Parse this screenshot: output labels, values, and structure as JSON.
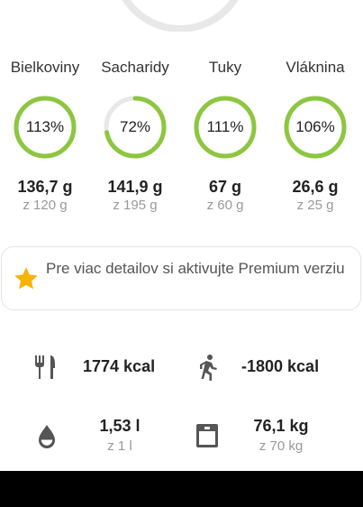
{
  "colors": {
    "accent": "#8dc63f",
    "track": "#e8e8e8",
    "star": "#f6b400",
    "icon": "#555555"
  },
  "macros": [
    {
      "label": "Bielkoviny",
      "percent_text": "113%",
      "percent": 113,
      "value": "136,7 g",
      "goal": "z 120 g"
    },
    {
      "label": "Sacharidy",
      "percent_text": "72%",
      "percent": 72,
      "value": "141,9 g",
      "goal": "z 195 g"
    },
    {
      "label": "Tuky",
      "percent_text": "111%",
      "percent": 111,
      "value": "67 g",
      "goal": "z 60 g"
    },
    {
      "label": "Vláknina",
      "percent_text": "106%",
      "percent": 106,
      "value": "26,6 g",
      "goal": "z 25 g"
    }
  ],
  "premium": {
    "text": "Pre viac detailov si aktivujte Premium verziu",
    "icon": "star-icon"
  },
  "stats": {
    "food": {
      "icon": "fork-knife-icon",
      "value": "1774 kcal"
    },
    "exercise": {
      "icon": "running-icon",
      "value": "-1800 kcal"
    },
    "water": {
      "icon": "water-drop-icon",
      "value": "1,53 l",
      "goal": "z 1 l"
    },
    "weight": {
      "icon": "scale-icon",
      "value": "76,1 kg",
      "goal": "z 70 kg"
    }
  }
}
